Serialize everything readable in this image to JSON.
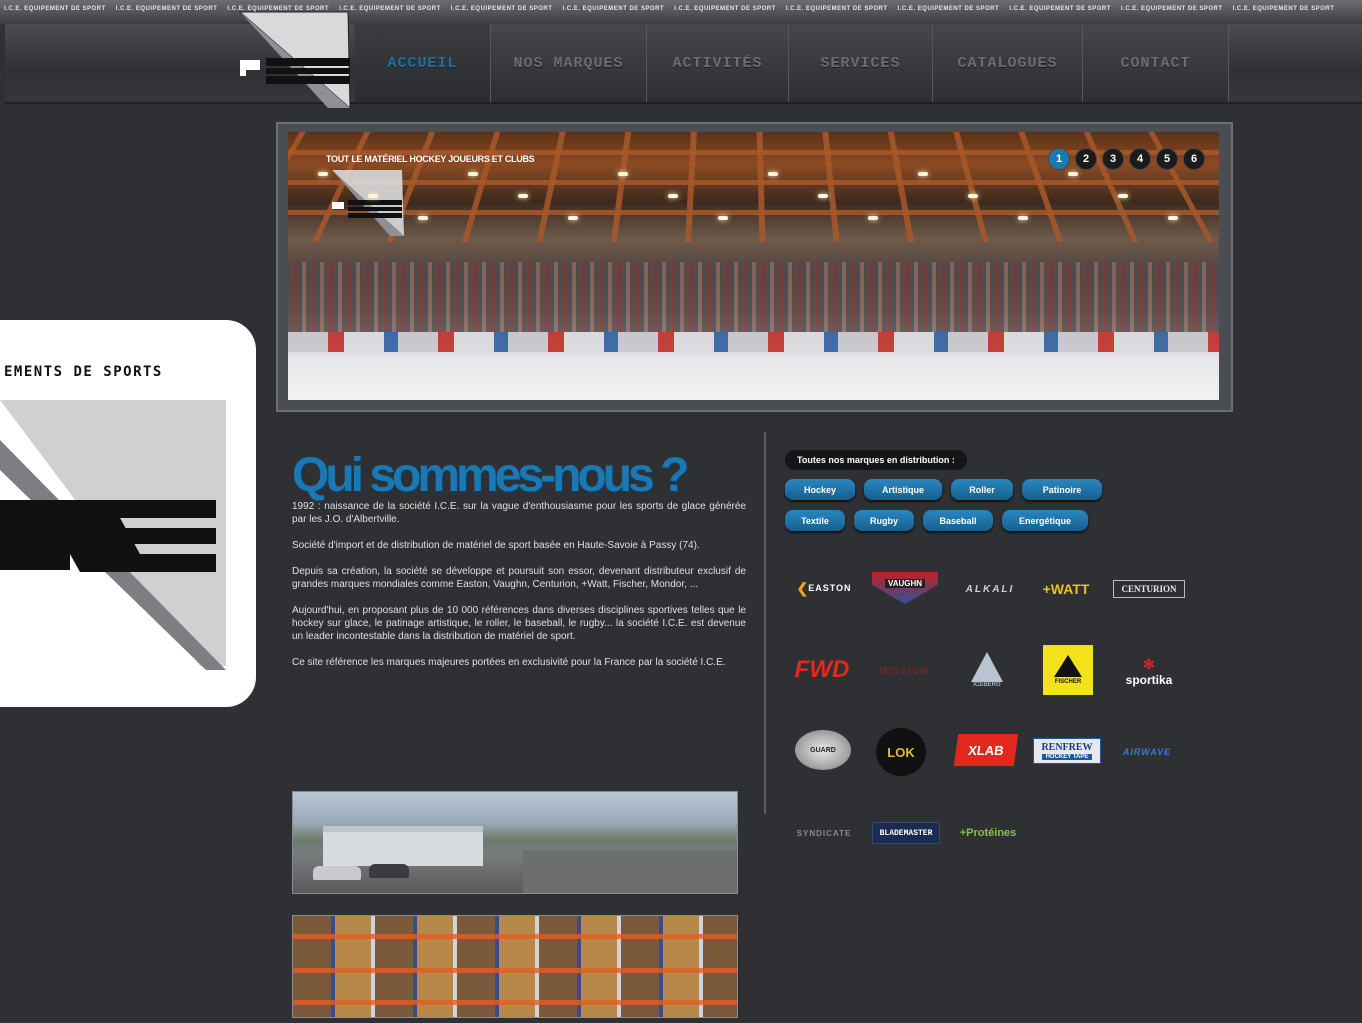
{
  "ticker": {
    "text": "I.C.E. EQUIPEMENT DE SPORT"
  },
  "nav": {
    "items": [
      {
        "label": "Accueil",
        "active": true
      },
      {
        "label": "Nos marques",
        "active": false
      },
      {
        "label": "Activités",
        "active": false
      },
      {
        "label": "Services",
        "active": false
      },
      {
        "label": "Catalogues",
        "active": false
      },
      {
        "label": "Contact",
        "active": false
      }
    ]
  },
  "hero": {
    "caption": "Tout le matériel hockey joueurs et clubs",
    "slides": [
      "1",
      "2",
      "3",
      "4",
      "5",
      "6"
    ],
    "active_slide": "1"
  },
  "side_panel": {
    "tagline": "EMENTS DE SPORTS"
  },
  "about": {
    "title": "Qui sommes-nous ?",
    "paragraphs": [
      "1992 : naissance de la société I.C.E. sur la vague d'enthousiasme pour les sports de glace générée par les J.O. d'Albertville.",
      "Société d'import et de distribution de matériel de sport basée en Haute-Savoie à Passy (74).",
      "Depuis sa création, la société se développe et poursuit son essor, devenant distributeur exclusif de grandes marques mondiales comme Easton, Vaughn, Centurion, +Watt, Fischer, Mondor, ...",
      "Aujourd'hui, en proposant plus de 10 000 références dans diverses disciplines sportives telles que le hockey sur glace, le patinage artistique, le roller, le baseball, le rugby... la société I.C.E. est devenue un leader incontestable dans la distribution de matériel de sport.",
      "Ce site référence les marques majeures portées en exclusivité pour la France par la société I.C.E."
    ]
  },
  "brands": {
    "heading": "Toutes nos marques en distribution :",
    "categories_row1": [
      "Hockey",
      "Artistique",
      "Roller",
      "Patinoire"
    ],
    "categories_row2": [
      "Textile",
      "Rugby",
      "Baseball",
      "Energétique"
    ],
    "logos": {
      "easton": "EASTON",
      "vaughn": "VAUGHN",
      "mondor": "ALKALI",
      "watt": "+WATT",
      "centurion": "CENTURION",
      "fwd": "FWD",
      "mission": "MISSION",
      "iceberg": "ICEBERG",
      "fischer": "FISCHER",
      "sportika": "sportika",
      "guard": "GUARD",
      "lok": "LOK",
      "xlab": "XLAB",
      "renfrew": "RENFREW",
      "renfrew_sub": "HOCKEY TAPE",
      "airwave": "AIRWAVE",
      "syndicate": "SYNDICATE",
      "blademaster": "BLADEMASTER",
      "proteines": "+Protéines"
    }
  },
  "colors": {
    "accent": "#1a78b4",
    "background": "#2e3033",
    "nav_text": "#6a6d72"
  }
}
